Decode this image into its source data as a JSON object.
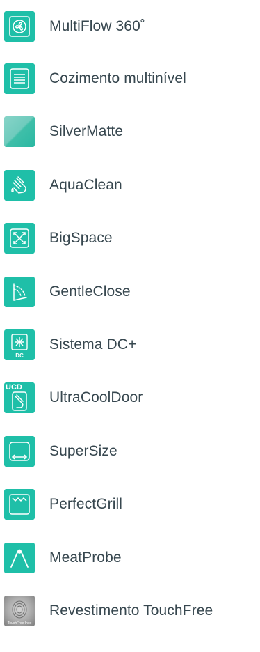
{
  "features": [
    {
      "label": "MultiFlow 360˚",
      "icon": "fan-icon"
    },
    {
      "label": "Cozimento multinível",
      "icon": "multilevel-icon"
    },
    {
      "label": "SilverMatte",
      "icon": "silvermatte-icon"
    },
    {
      "label": "AquaClean",
      "icon": "aquaclean-icon"
    },
    {
      "label": "BigSpace",
      "icon": "bigspace-icon"
    },
    {
      "label": "GentleClose",
      "icon": "gentleclose-icon"
    },
    {
      "label": "Sistema DC+",
      "icon": "dc-icon",
      "badge": "DC"
    },
    {
      "label": "UltraCoolDoor",
      "icon": "ultracooldoor-icon",
      "badge": "UCD"
    },
    {
      "label": "SuperSize",
      "icon": "supersize-icon"
    },
    {
      "label": "PerfectGrill",
      "icon": "perfectgrill-icon"
    },
    {
      "label": "MeatProbe",
      "icon": "meatprobe-icon"
    },
    {
      "label": "Revestimento TouchFree",
      "icon": "touchfree-icon",
      "badge": "TouchFree Inox"
    }
  ],
  "colors": {
    "accent": "#1fbfa8",
    "text": "#37474f"
  }
}
